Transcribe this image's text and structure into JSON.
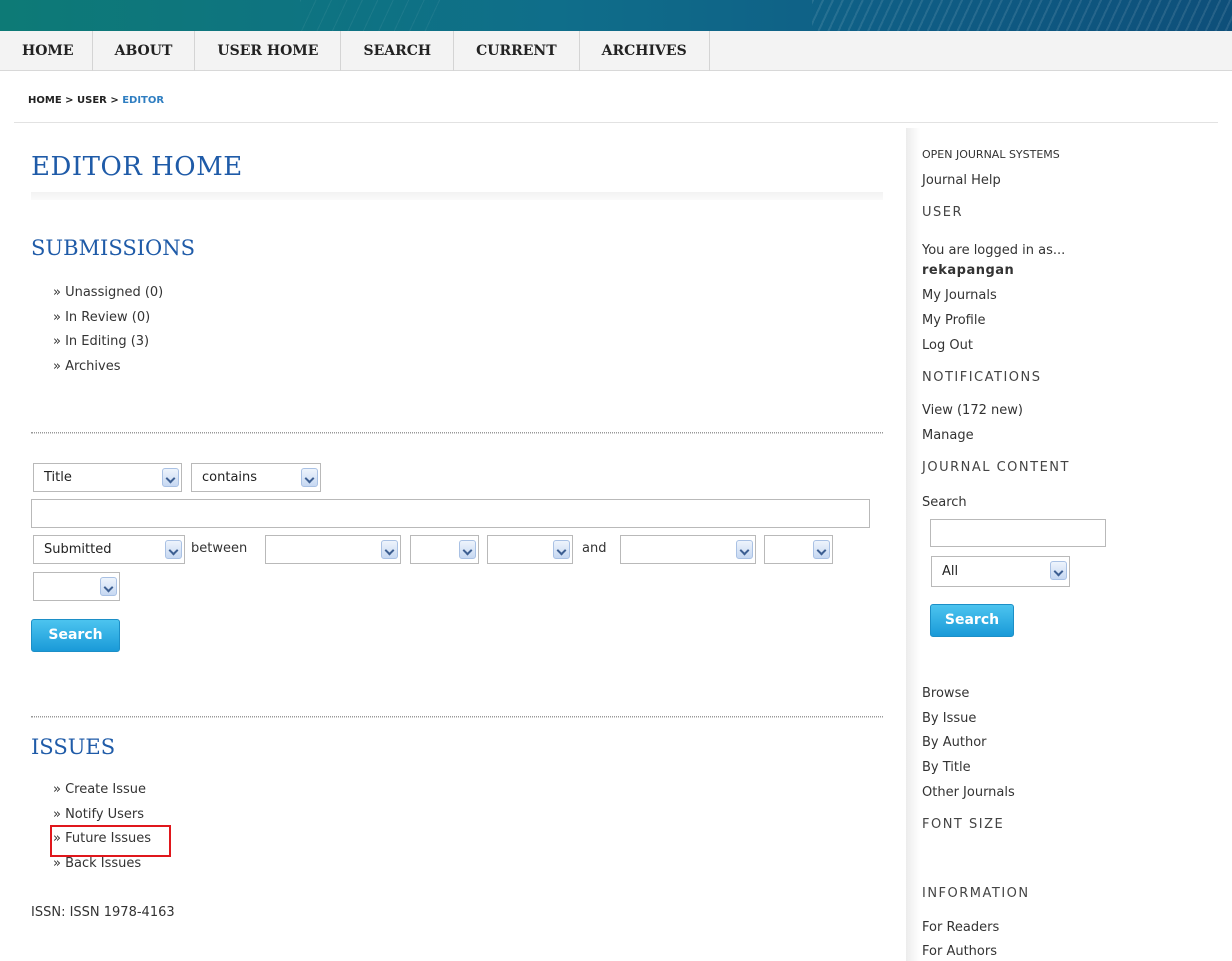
{
  "nav": {
    "items": [
      "HOME",
      "ABOUT",
      "USER HOME",
      "SEARCH",
      "CURRENT",
      "ARCHIVES"
    ]
  },
  "breadcrumb": {
    "home": "HOME",
    "sep1": " > ",
    "user": "USER",
    "sep2": " > ",
    "current": "EDITOR"
  },
  "page": {
    "title": "EDITOR HOME"
  },
  "submissions": {
    "title": "SUBMISSIONS",
    "items": [
      "» Unassigned (0)",
      "» In Review (0)",
      "» In Editing (3)",
      "» Archives"
    ]
  },
  "search_form": {
    "field_select": "Title",
    "match_select": "contains",
    "query_value": "",
    "date_field_select": "Submitted",
    "between_label": "between",
    "and_label": "and",
    "search_button": "Search"
  },
  "issues": {
    "title": "ISSUES",
    "items": [
      "» Create Issue",
      "» Notify Users",
      "» Future Issues",
      "» Back Issues"
    ]
  },
  "footer": {
    "issn": "ISSN: ISSN 1978-4163"
  },
  "sidebar": {
    "ojs_label": "OPEN JOURNAL SYSTEMS",
    "journal_help": "Journal Help",
    "user_heading": "USER",
    "logged_in_as": "You are logged in as...",
    "username": "rekapangan",
    "my_journals": "My Journals",
    "my_profile": "My Profile",
    "log_out": "Log Out",
    "notifications_heading": "NOTIFICATIONS",
    "view_notifications": "View (172 new)",
    "manage": "Manage",
    "journal_content_heading": "JOURNAL CONTENT",
    "search_label": "Search",
    "search_value": "",
    "scope_select": "All",
    "search_button": "Search",
    "browse_label": "Browse",
    "by_issue": "By Issue",
    "by_author": "By Author",
    "by_title": "By Title",
    "other_journals": "Other Journals",
    "font_size_heading": "FONT SIZE",
    "information_heading": "INFORMATION",
    "for_readers": "For Readers",
    "for_authors": "For Authors"
  },
  "colors": {
    "link_blue": "#1f5ba8",
    "button_blue": "#1a9ad8",
    "highlight_red": "#e0171c"
  }
}
